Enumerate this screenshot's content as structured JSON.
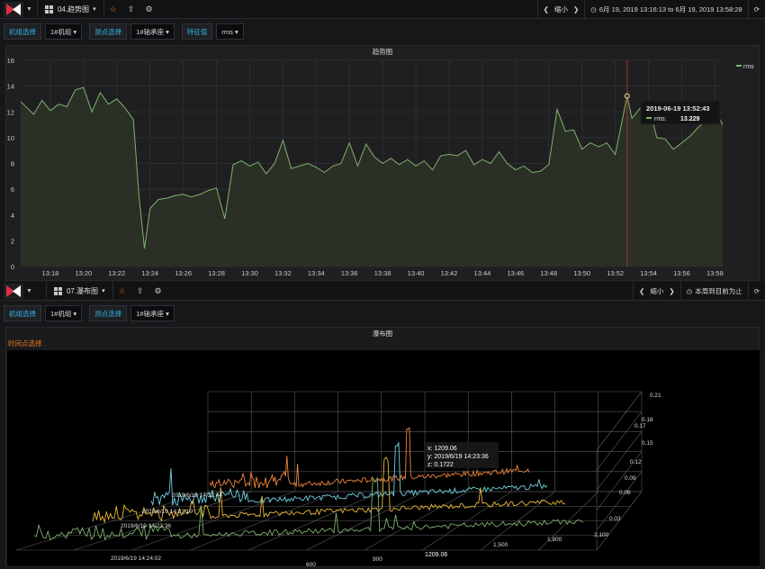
{
  "top_nav": {
    "dashboard_title": "04.趋势图",
    "zoom_out": "缩小",
    "time_range": "6月 19, 2019 13:16:13 to 6月 19, 2019 13:58:28"
  },
  "top_vars": [
    {
      "label": "机组选择",
      "value": "1#机组"
    },
    {
      "label": "测点选择",
      "value": "1#轴承座"
    },
    {
      "label": "特征值",
      "value": "rms"
    }
  ],
  "trend_panel": {
    "title": "趋势图",
    "legend": "rms",
    "tooltip_time": "2019-06-19 13:52:43",
    "tooltip_series": "rms:",
    "tooltip_value": "13.229"
  },
  "bottom_nav": {
    "dashboard_title": "07.瀑布图",
    "zoom_out": "缩小",
    "time_range": "本周到目前为止"
  },
  "bottom_vars": [
    {
      "label": "机组选择",
      "value": "1#机组"
    },
    {
      "label": "测点选择",
      "value": "1#轴承座"
    }
  ],
  "waterfall_panel": {
    "title": "瀑布图",
    "time_select": "时间点选择",
    "tooltip_x": "x: 1209.06",
    "tooltip_y": "y: 2019/6/19 14:23:36",
    "tooltip_z": "z: 0.1722",
    "x_pointer_label": "1209.06",
    "y_labels": [
      "2019/6/19 14:22:44",
      "2019/6/19 14:23:10",
      "2019/6/19 14:23:36",
      "2019/6/19 14:24:02"
    ],
    "x_labels": [
      "900",
      "1,500",
      "1,800",
      "2,100",
      "600"
    ],
    "z_labels": [
      "0.21",
      "0.18",
      "0.17",
      "0.15",
      "0.12",
      "0.09",
      "0.06",
      "0.03"
    ]
  },
  "chart_data": {
    "type": "line",
    "series": [
      {
        "name": "rms",
        "x": [
          "13:16:13",
          "13:17",
          "13:17:30",
          "13:18",
          "13:18:30",
          "13:19",
          "13:19:30",
          "13:20",
          "13:20:30",
          "13:21",
          "13:21:30",
          "13:22",
          "13:22:30",
          "13:23",
          "13:23:20",
          "13:23:40",
          "13:24",
          "13:24:30",
          "13:25",
          "13:25:30",
          "13:26",
          "13:26:30",
          "13:27",
          "13:27:30",
          "13:28",
          "13:28:30",
          "13:29",
          "13:29:30",
          "13:30",
          "13:30:30",
          "13:31",
          "13:31:30",
          "13:32",
          "13:32:30",
          "13:33",
          "13:33:30",
          "13:34",
          "13:34:30",
          "13:35",
          "13:35:30",
          "13:36",
          "13:36:30",
          "13:37",
          "13:37:30",
          "13:38",
          "13:38:30",
          "13:39",
          "13:39:30",
          "13:40",
          "13:40:30",
          "13:41",
          "13:41:30",
          "13:42",
          "13:42:30",
          "13:43",
          "13:43:30",
          "13:44",
          "13:44:30",
          "13:45",
          "13:45:30",
          "13:46",
          "13:46:30",
          "13:47",
          "13:47:30",
          "13:48",
          "13:48:30",
          "13:49",
          "13:49:30",
          "13:50",
          "13:50:30",
          "13:51",
          "13:51:30",
          "13:52",
          "13:52:43",
          "13:53",
          "13:53:30",
          "13:54",
          "13:54:30",
          "13:55",
          "13:55:30",
          "13:56",
          "13:56:30",
          "13:57",
          "13:57:30",
          "13:58",
          "13:58:28"
        ],
        "values": [
          12.8,
          11.8,
          12.9,
          12.1,
          12.6,
          12.4,
          13.7,
          13.9,
          12.0,
          13.5,
          12.6,
          13.0,
          12.3,
          11.4,
          5.5,
          1.4,
          4.5,
          5.2,
          5.3,
          5.5,
          5.6,
          5.4,
          5.6,
          5.9,
          6.1,
          3.7,
          7.9,
          8.2,
          7.8,
          8.1,
          7.2,
          8.0,
          9.8,
          7.6,
          7.8,
          8.0,
          7.7,
          7.3,
          7.8,
          8.0,
          9.6,
          7.8,
          9.5,
          8.5,
          8.0,
          8.4,
          7.9,
          8.3,
          7.8,
          8.2,
          7.5,
          8.6,
          8.7,
          8.6,
          9.0,
          7.9,
          8.3,
          8.0,
          8.9,
          8.0,
          7.5,
          7.8,
          7.3,
          7.4,
          7.9,
          12.2,
          10.5,
          10.6,
          9.1,
          9.6,
          9.3,
          9.6,
          8.7,
          13.229,
          11.5,
          12.3,
          12.6,
          10.0,
          9.9,
          9.1,
          9.6,
          10.1,
          10.8,
          11.3,
          12.3,
          11.0
        ]
      }
    ],
    "xlabel": "",
    "ylabel": "",
    "ylim": [
      0,
      16
    ],
    "x_ticks": [
      "13:18",
      "13:20",
      "13:22",
      "13:24",
      "13:26",
      "13:28",
      "13:30",
      "13:32",
      "13:34",
      "13:36",
      "13:38",
      "13:40",
      "13:42",
      "13:44",
      "13:46",
      "13:48",
      "13:50",
      "13:52",
      "13:54",
      "13:56",
      "13:58"
    ],
    "y_ticks": [
      0,
      2,
      4,
      6,
      8,
      10,
      12,
      14,
      16
    ],
    "grid": true,
    "legend_position": "top-right"
  },
  "colors": {
    "line": "#7eb26d",
    "fill": "#2a3025",
    "label_blue": "#33b5e5",
    "star": "#eb7b18",
    "crosshair": "#a62f2f",
    "waterfall_series": [
      "#7eb26d",
      "#eab839",
      "#6ed0e0",
      "#ef843c"
    ]
  }
}
